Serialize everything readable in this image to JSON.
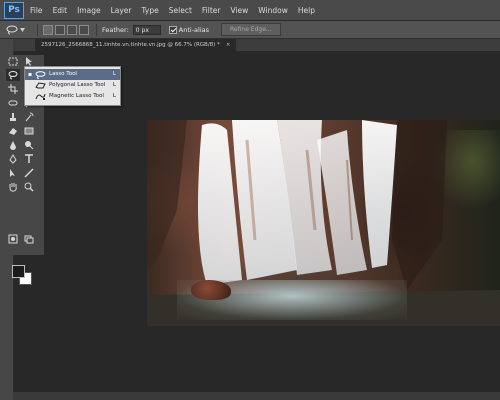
{
  "app": {
    "logo_text": "Ps"
  },
  "menu": [
    "File",
    "Edit",
    "Image",
    "Layer",
    "Type",
    "Select",
    "Filter",
    "View",
    "Window",
    "Help"
  ],
  "options": {
    "feather_label": "Feather:",
    "feather_value": "0 px",
    "anti_alias_label": "Anti-alias",
    "anti_alias_checked": true,
    "refine_edge_label": "Refine Edge..."
  },
  "document": {
    "tab_title": "2597126_2566868_11.tinhte.vn.tinhte.vn.jpg @ 66.7% (RGB/8) *",
    "close_glyph": "×"
  },
  "flyout": {
    "items": [
      {
        "label": "Lasso Tool",
        "key": "L",
        "selected": true,
        "icon": "lasso-icon"
      },
      {
        "label": "Polygonal Lasso Tool",
        "key": "L",
        "selected": false,
        "icon": "polygonal-lasso-icon"
      },
      {
        "label": "Magnetic Lasso Tool",
        "key": "L",
        "selected": false,
        "icon": "magnetic-lasso-icon"
      }
    ],
    "selected_bullet": "▪"
  },
  "colors": {
    "foreground": "#1a1a1a",
    "background": "#ffffff",
    "accent": "#5aa3e8"
  }
}
